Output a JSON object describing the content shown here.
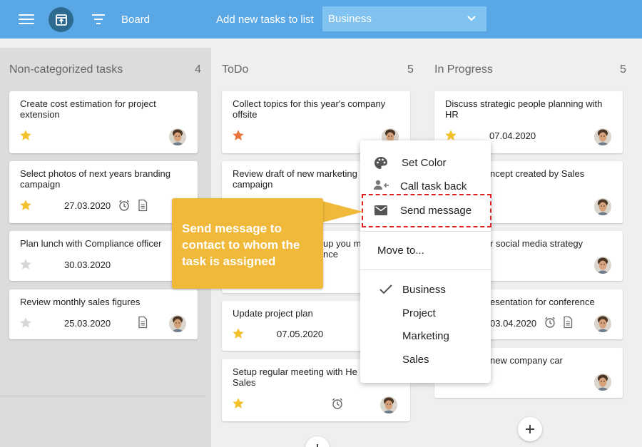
{
  "topbar": {
    "board_label": "Board",
    "add_label": "Add new tasks to list",
    "selected_list": "Business"
  },
  "columns": [
    {
      "title": "Non-categorized tasks",
      "count": "4"
    },
    {
      "title": "ToDo",
      "count": "5"
    },
    {
      "title": "In Progress",
      "count": "5"
    }
  ],
  "cards": {
    "c1": {
      "title": "Create cost estimation for project extension",
      "date": ""
    },
    "c2": {
      "title": "Select photos of next years branding campaign",
      "date": "27.03.2020"
    },
    "c3": {
      "title": "Plan lunch with Compliance officer",
      "date": "30.03.2020"
    },
    "c4": {
      "title": "Review monthly sales figures",
      "date": "25.03.2020"
    },
    "t1": {
      "title": "Collect topics for this year's company offsite",
      "date": ""
    },
    "t2": {
      "title": "Review draft of new marketing campaign",
      "date": ""
    },
    "t3": {
      "title": "up you m",
      "title2": "nce",
      "date": ""
    },
    "t4": {
      "title": "Update project plan",
      "date": "07.05.2020"
    },
    "t5": {
      "title": "Setup regular meeting with He",
      "title2": "Sales",
      "date": ""
    },
    "p1": {
      "title": "Discuss strategic people planning with HR",
      "date": "07.04.2020"
    },
    "p2": {
      "title": "ncept created by Sales",
      "date": ""
    },
    "p3": {
      "title": "r social media strategy",
      "date": ""
    },
    "p4": {
      "title": "esentation for conference",
      "date": "03.04.2020"
    },
    "p5": {
      "title": "new company car",
      "date": ""
    }
  },
  "menu": {
    "set_color": "Set Color",
    "call_back": "Call task back",
    "send_message": "Send message",
    "move_to": "Move to...",
    "lists": [
      "Business",
      "Project",
      "Marketing",
      "Sales"
    ]
  },
  "callout": {
    "text": "Send message to contact to whom the task is assigned"
  },
  "colors": {
    "topbar": "#5aa7e6",
    "callout": "#f0b93a",
    "star_gold": "#f3c12c",
    "star_orange": "#e8743b",
    "highlight": "#e02020"
  }
}
